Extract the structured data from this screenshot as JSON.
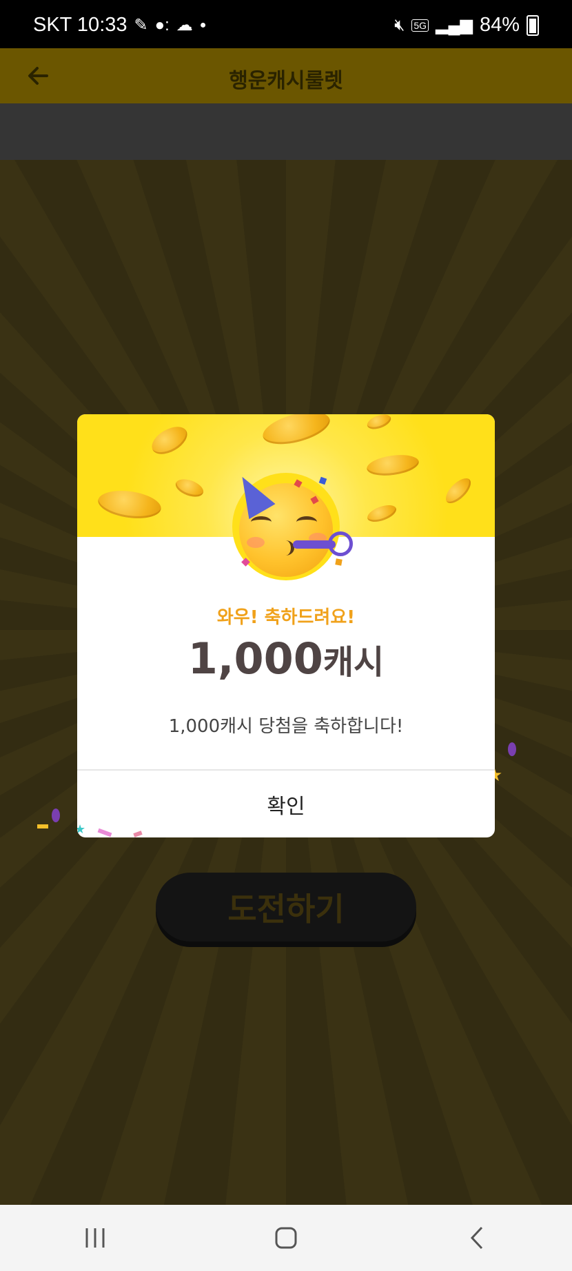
{
  "status_bar": {
    "carrier_time": "SKT 10:33",
    "battery": "84%",
    "network": "5G"
  },
  "header": {
    "title": "행운캐시룰렛",
    "back_icon": "arrow-left-icon"
  },
  "modal": {
    "congrats": "와우! 축하드려요!",
    "prize_amount": "1,000",
    "prize_unit": "캐시",
    "description": "1,000캐시 당첨을 축하합니다!",
    "confirm_label": "확인",
    "illustration": "party-face-icon"
  },
  "main": {
    "challenge_label": "도전하기"
  },
  "nav": {
    "recents_icon": "recents-icon",
    "home_icon": "home-icon",
    "back_icon": "back-chevron-icon"
  },
  "colors": {
    "accent_yellow": "#ffe01a",
    "congrats_orange": "#f0a11a",
    "prize_text": "#4f4444"
  }
}
